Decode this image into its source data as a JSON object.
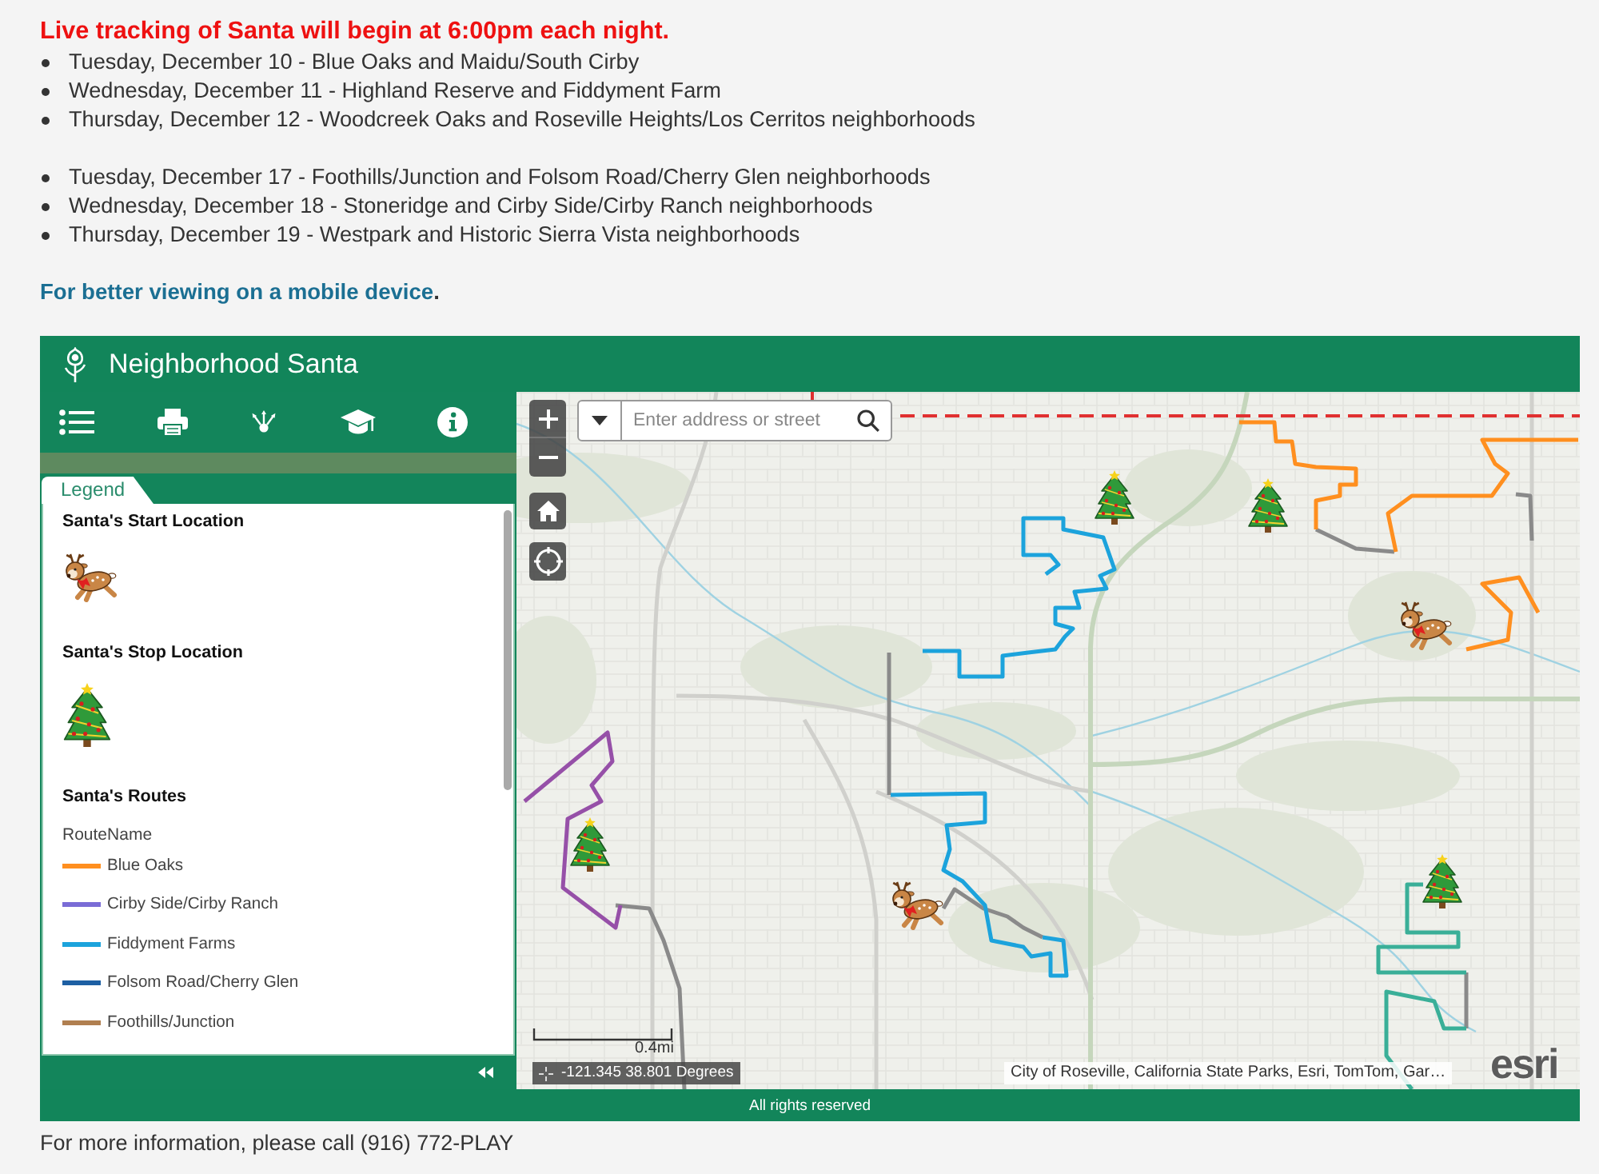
{
  "notice": {
    "heading": "Live tracking of Santa will begin at 6:00pm each night.",
    "schedule": [
      {
        "items": [
          "Tuesday, December 10 - Blue Oaks and Maidu/South Cirby",
          "Wednesday, December 11 - Highland Reserve and Fiddyment Farm",
          "Thursday, December 12 - Woodcreek Oaks and Roseville Heights/Los Cerritos neighborhoods"
        ]
      },
      {
        "items": [
          "Tuesday, December 17 - Foothills/Junction and Folsom Road/Cherry Glen neighborhoods",
          "Wednesday, December 18 - Stoneridge and Cirby Side/Cirby Ranch neighborhoods",
          "Thursday, December 19 - Westpark and Historic Sierra Vista neighborhoods"
        ]
      }
    ],
    "mobile": {
      "link": "For better viewing on a mobile device",
      "tail": "."
    }
  },
  "app": {
    "title": "Neighborhood Santa",
    "legend": {
      "tab": "Legend",
      "sections": [
        {
          "kind": "start",
          "title": "Santa's Start Location"
        },
        {
          "kind": "stop",
          "title": "Santa's Stop Location"
        },
        {
          "kind": "routes",
          "title": "Santa's Routes",
          "field": "RouteName",
          "routes": [
            {
              "name": "Blue Oaks",
              "color": "#ff8f1f"
            },
            {
              "name": "Cirby Side/Cirby Ranch",
              "color": "#7a6cd6"
            },
            {
              "name": "Fiddyment Farms",
              "color": "#1ca3dc"
            },
            {
              "name": "Folsom Road/Cherry Glen",
              "color": "#1d5fa3"
            },
            {
              "name": "Foothills/Junction",
              "color": "#b07f50"
            }
          ]
        }
      ]
    },
    "map": {
      "search": {
        "placeholder": "Enter address or street"
      },
      "scale": "0.4mi",
      "coordinates": "-121.345 38.801 Degrees",
      "attribution": "City of Roseville, California State Parks, Esri, TomTom, Gar…",
      "logo": "esri"
    },
    "footer": "All rights reserved"
  },
  "contact": "For more information, please call (916) 772-PLAY"
}
